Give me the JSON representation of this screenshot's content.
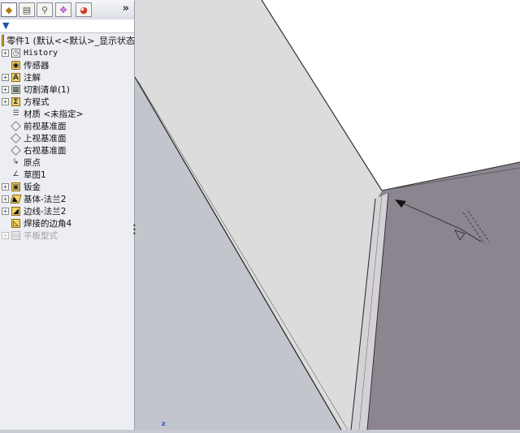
{
  "panel": {
    "tabs": [
      {
        "name": "feature-manager",
        "icon": "featuremanager-icon"
      },
      {
        "name": "property-manager",
        "icon": "propertymanager-icon"
      },
      {
        "name": "configuration-manager",
        "icon": "configurationmanager-icon"
      },
      {
        "name": "dimxpert-manager",
        "icon": "dimxpert-icon"
      },
      {
        "name": "display-manager",
        "icon": "displaymanager-icon"
      }
    ],
    "expand_label": "»",
    "filter_icon": "filter-icon",
    "root_label": "零件1  (默认<<默认>_显示状态",
    "items": [
      {
        "label": "History",
        "icon": "history-icon",
        "expandable": true
      },
      {
        "label": "传感器",
        "icon": "sensor-icon",
        "expandable": false
      },
      {
        "label": "注解",
        "icon": "annotation-icon",
        "icon_glyph": "A",
        "expandable": true
      },
      {
        "label": "切割清单(1)",
        "icon": "cutlist-icon",
        "expandable": true
      },
      {
        "label": "方程式",
        "icon": "equation-icon",
        "icon_glyph": "Σ",
        "expandable": true
      },
      {
        "label": "材质 <未指定>",
        "icon": "material-icon",
        "icon_glyph": "☰",
        "expandable": false
      },
      {
        "label": "前视基准面",
        "icon": "plane-icon",
        "expandable": false
      },
      {
        "label": "上视基准面",
        "icon": "plane-icon",
        "expandable": false
      },
      {
        "label": "右视基准面",
        "icon": "plane-icon",
        "expandable": false
      },
      {
        "label": "原点",
        "icon": "origin-icon",
        "icon_glyph": "↳",
        "expandable": false
      },
      {
        "label": "草图1",
        "icon": "sketch-icon",
        "icon_glyph": "∠",
        "expandable": false
      },
      {
        "label": "钣金",
        "icon": "sheetmetal-icon",
        "expandable": true
      },
      {
        "label": "基体-法兰2",
        "icon": "base-flange-icon",
        "expandable": true
      },
      {
        "label": "边线-法兰2",
        "icon": "edge-flange-icon",
        "expandable": true
      },
      {
        "label": "焊接的边角4",
        "icon": "welded-corner-icon",
        "expandable": false
      },
      {
        "label": "平板型式",
        "icon": "flat-pattern-icon",
        "expandable": true,
        "disabled": true
      }
    ]
  },
  "viewport": {
    "axis_label": "z",
    "colors": {
      "background": "#c9cbd2",
      "top_face": "#ffffff",
      "front_face": "#dcdcdc",
      "side_face": "#8c8590",
      "edge": "#333333"
    }
  }
}
